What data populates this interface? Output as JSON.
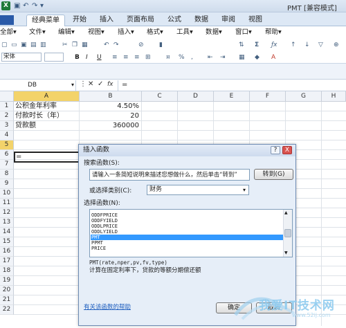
{
  "window": {
    "title": "PMT [兼容模式]",
    "logo": "X"
  },
  "ribbon_tabs": [
    "经典菜单",
    "开始",
    "插入",
    "页面布局",
    "公式",
    "数据",
    "审阅",
    "视图"
  ],
  "active_tab": "经典菜单",
  "classic_menu": [
    "全部▾",
    "文件▾",
    "编辑▾",
    "视图▾",
    "插入▾",
    "格式▾",
    "工具▾",
    "数据▾",
    "窗口▾",
    "帮助▾"
  ],
  "format_bar": {
    "font": "宋体",
    "bold": "B",
    "italic": "I",
    "underline": "U"
  },
  "formula_bar": {
    "name_box": "DB",
    "cancel": "✕",
    "enter": "✓",
    "fx": "fx",
    "content": "="
  },
  "columns": [
    "A",
    "B",
    "C",
    "D",
    "E",
    "F",
    "G",
    "H"
  ],
  "rows": [
    "1",
    "2",
    "3",
    "4",
    "5",
    "6",
    "7",
    "8",
    "9",
    "10",
    "11",
    "12",
    "13",
    "14",
    "15",
    "16",
    "17",
    "18",
    "19",
    "20",
    "21",
    "22"
  ],
  "cells": {
    "a1": "公积金年利率",
    "b1": "4.50%",
    "a2": "付款时长（年）",
    "b2": "20",
    "a3": "贷款额",
    "b3": "360000",
    "a5": "="
  },
  "dialog": {
    "title": "插入函数",
    "help": "?",
    "close": "X",
    "search_label": "搜索函数(S):",
    "search_value": "请输入一条简短说明来描述您想做什么，然后单击“转到”",
    "go_button": "转到(G)",
    "category_label": "或选择类别(C):",
    "category_value": "财务",
    "select_label": "选择函数(N):",
    "functions": [
      "ODDFPRICE",
      "ODDFYIELD",
      "ODDLPRICE",
      "ODDLYIELD",
      "PMT",
      "PPMT",
      "PRICE"
    ],
    "selected_function": "PMT",
    "syntax": "PMT(rate,nper,pv,fv,type)",
    "description": "计算在固定利率下，贷款的等额分期偿还额",
    "help_link": "有关该函数的帮助",
    "ok_button": "确定",
    "cancel_button": "取消"
  },
  "watermark": {
    "text": "我爱IT技术网",
    "url": "www.52ij.com"
  }
}
